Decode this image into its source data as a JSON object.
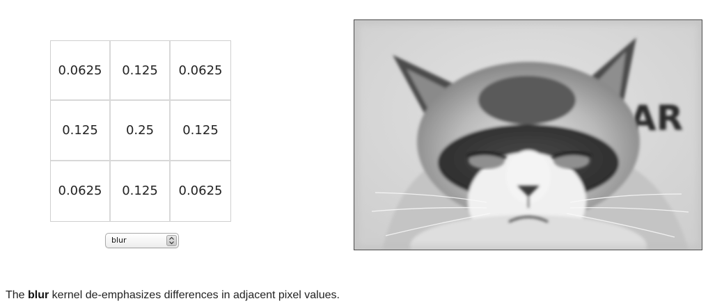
{
  "kernel": {
    "cells": [
      [
        "0.0625",
        "0.125",
        "0.0625"
      ],
      [
        "0.125",
        "0.25",
        "0.125"
      ],
      [
        "0.0625",
        "0.125",
        "0.0625"
      ]
    ]
  },
  "kernel_select": {
    "selected": "blur"
  },
  "image": {
    "background_text": "AR",
    "colors": {
      "background": "#dcdcdc",
      "fur_dark": "#3a3a3a",
      "fur_light": "#cfcfcf",
      "muzzle": "#f2f2f2",
      "frame_border": "#4a4a4a"
    }
  },
  "caption": {
    "prefix": "The ",
    "kernel_name": "blur",
    "suffix": " kernel de-emphasizes differences in adjacent pixel values."
  }
}
